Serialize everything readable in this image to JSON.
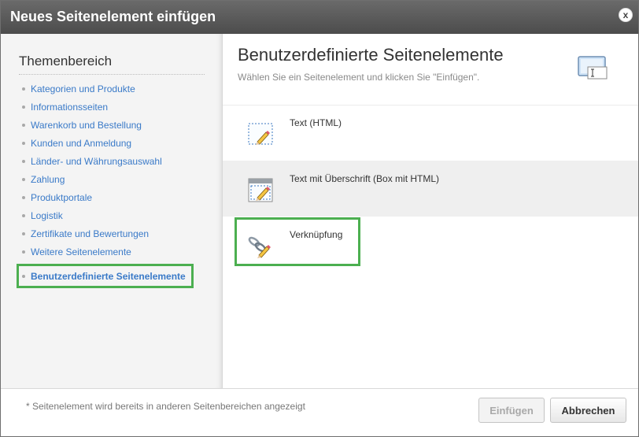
{
  "dialog": {
    "title": "Neues Seitenelement einfügen",
    "close_icon": "x"
  },
  "sidebar": {
    "heading": "Themenbereich",
    "items": [
      {
        "label": "Kategorien und Produkte"
      },
      {
        "label": "Informationsseiten"
      },
      {
        "label": "Warenkorb und Bestellung"
      },
      {
        "label": "Kunden und Anmeldung"
      },
      {
        "label": "Länder- und Währungsauswahl"
      },
      {
        "label": "Zahlung"
      },
      {
        "label": "Produktportale"
      },
      {
        "label": "Logistik"
      },
      {
        "label": "Zertifikate und Bewertungen"
      },
      {
        "label": "Weitere Seitenelemente"
      }
    ],
    "active_item": {
      "label": "Benutzerdefinierte Seitenelemente"
    }
  },
  "main": {
    "title": "Benutzerdefinierte Seitenelemente",
    "subtitle": "Wählen Sie ein Seitenelement und klicken Sie \"Einfügen\".",
    "elements": [
      {
        "label": "Text (HTML)",
        "icon": "text-html-icon"
      },
      {
        "label": "Text mit Überschrift (Box mit HTML)",
        "icon": "text-box-icon"
      },
      {
        "label": "Verknüpfung",
        "icon": "link-icon"
      }
    ]
  },
  "footer": {
    "note": "* Seitenelement wird bereits in anderen Seitenbereichen angezeigt",
    "insert_label": "Einfügen",
    "cancel_label": "Abbrechen"
  },
  "colors": {
    "titlebar": "#555555",
    "link": "#3a7ac8",
    "highlight": "#4caf50"
  }
}
